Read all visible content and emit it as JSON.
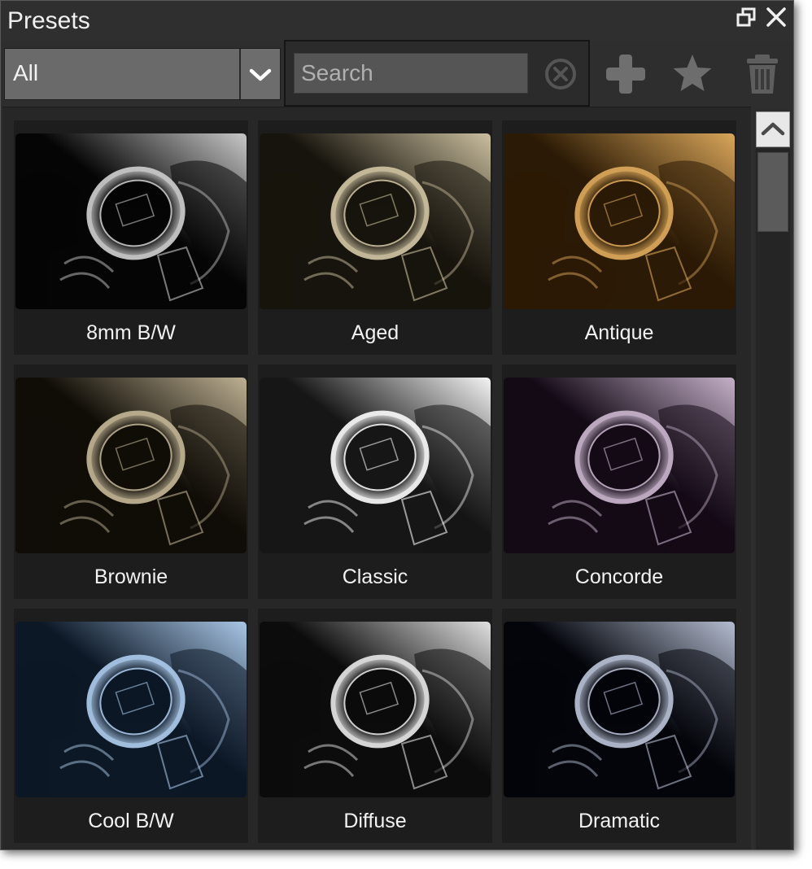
{
  "panel": {
    "title": "Presets"
  },
  "window_controls": {
    "restore_icon": "restore-window-icon",
    "close_icon": "close-icon"
  },
  "filter": {
    "selected": "All",
    "icon": "chevron-down-icon"
  },
  "search": {
    "placeholder": "Search",
    "value": "",
    "clear_icon": "clear-circle-icon"
  },
  "toolbar": {
    "add_icon": "plus-icon",
    "favorite_icon": "star-icon",
    "delete_icon": "trash-icon"
  },
  "presets": [
    {
      "label": "8mm B/W",
      "tint": "#c8c8c8",
      "dark": "#050505"
    },
    {
      "label": "Aged",
      "tint": "#cbbf9f",
      "dark": "#17140d"
    },
    {
      "label": "Antique",
      "tint": "#d9a65a",
      "dark": "#2b1a05"
    },
    {
      "label": "Brownie",
      "tint": "#bdb092",
      "dark": "#100d07"
    },
    {
      "label": "Classic",
      "tint": "#f4f4f4",
      "dark": "#161616"
    },
    {
      "label": "Concorde",
      "tint": "#c4b0c8",
      "dark": "#140a16"
    },
    {
      "label": "Cool B/W",
      "tint": "#a9c6e6",
      "dark": "#0c1826"
    },
    {
      "label": "Diffuse",
      "tint": "#e0e0e0",
      "dark": "#0c0c0c"
    },
    {
      "label": "Dramatic",
      "tint": "#b4bcd0",
      "dark": "#03050b"
    }
  ],
  "scroll": {
    "position": 0.0,
    "up_icon": "chevron-up-icon"
  }
}
